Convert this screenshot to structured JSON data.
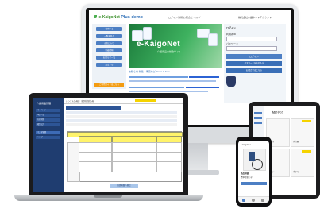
{
  "desktop": {
    "logo_brand": "e-KaigoNet",
    "logo_suffix": "Plus demo",
    "header_links": "ログイン情報  お問合せ  ヘルプ",
    "header_title": "株式会社介護ネットアカウント",
    "menu_items": [
      "検索する",
      "一覧を見る",
      "お気に入り",
      "新着情報",
      "お知らせ一覧",
      "設定する"
    ],
    "menu_highlight": "ご利用ガイドはこちら",
    "banner_title": "e-KaigoNet",
    "banner_sub": "介護用品の総合サイト",
    "tabs": "お知らせ   新着・予定など   News & Item",
    "right_panel": {
      "login_title": "ログイン",
      "user_label": "利用者ID",
      "pass_label": "パスワード",
      "login_button": "ログイン",
      "btn_one": "パスワードを忘れた方",
      "btn_two": "お問合せはこちら"
    }
  },
  "laptop": {
    "app_title": "介護用品管理",
    "side_items": [
      "マイページ",
      "申込一覧",
      "在庫管理",
      "帳票出力",
      "マスタ管理",
      "ヘルプ"
    ],
    "form_title": "レンタル計画書（個別援助計画）",
    "submit_label": "確認画面へ進む"
  },
  "tablet": {
    "title": "商品カタログ",
    "items": [
      "車いす",
      "歩行器",
      "ベッド",
      "手すり"
    ]
  },
  "phone": {
    "title": "商品詳細",
    "product": "標準型車いす",
    "brand": "e-KaigoNet"
  },
  "colors": {
    "brand_green": "#3a8f2a",
    "accent_blue": "#4d7fc4",
    "sidebar_navy": "#1f3d70",
    "highlight_yellow": "#fff36a",
    "orange": "#f39c12"
  }
}
